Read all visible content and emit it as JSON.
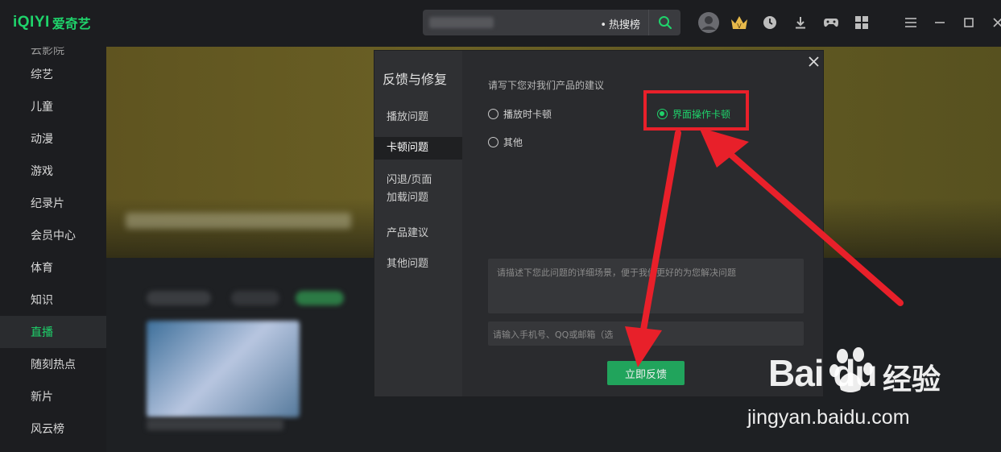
{
  "app": {
    "logo_latin": "iQIYI",
    "logo_cn": "爱奇艺"
  },
  "search": {
    "hot_label": "热搜榜"
  },
  "sidebar": {
    "items": [
      {
        "label": "云影院"
      },
      {
        "label": "综艺"
      },
      {
        "label": "儿童"
      },
      {
        "label": "动漫"
      },
      {
        "label": "游戏"
      },
      {
        "label": "纪录片"
      },
      {
        "label": "会员中心"
      },
      {
        "label": "体育"
      },
      {
        "label": "知识"
      },
      {
        "label": "直播",
        "active": true
      },
      {
        "label": "随刻热点"
      },
      {
        "label": "新片"
      },
      {
        "label": "风云榜"
      }
    ]
  },
  "dialog": {
    "title": "反馈与修复",
    "nav": [
      {
        "label": "播放问题"
      },
      {
        "label": "卡顿问题",
        "active": true
      },
      {
        "label": "闪退/页面"
      },
      {
        "label": "加载问题"
      },
      {
        "label": "产品建议"
      },
      {
        "label": "其他问题"
      }
    ],
    "prompt": "请写下您对我们产品的建议",
    "options": [
      {
        "label": "播放时卡顿",
        "selected": false
      },
      {
        "label": "界面操作卡顿",
        "selected": true
      },
      {
        "label": "其他",
        "selected": false
      }
    ],
    "description_placeholder": "请描述下您此问题的详细场景，便于我们更好的为您解决问题",
    "contact_placeholder": "请输入手机号、QQ或邮箱（选",
    "submit_label": "立即反馈"
  },
  "colors": {
    "accent": "#1fd36b",
    "annotation_red": "#e8202a",
    "submit_green": "#21a45c"
  },
  "watermark": {
    "brand_latin": "Bai du",
    "brand_cn": "经验",
    "url": "jingyan.baidu.com"
  }
}
